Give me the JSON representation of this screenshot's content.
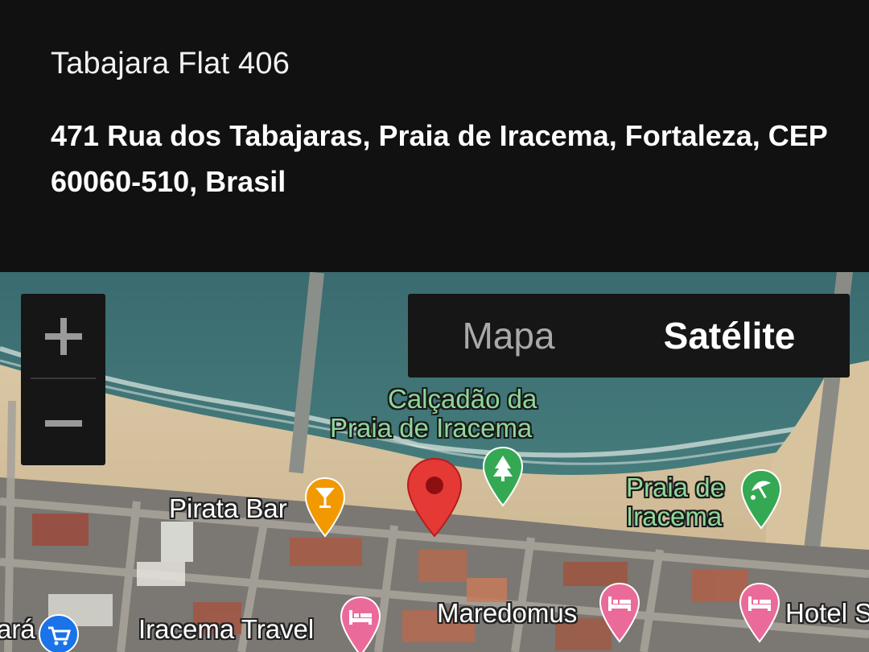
{
  "place": {
    "name": "Tabajara Flat 406",
    "address": "471 Rua dos Tabajaras, Praia de Iracema, Fortaleza, CEP 60060-510, Brasil"
  },
  "map": {
    "view_mode": "satellite",
    "zoom_controls": {
      "zoom_in_icon": "plus-icon",
      "zoom_out_icon": "minus-icon"
    },
    "map_type": {
      "map_label": "Mapa",
      "satellite_label": "Satélite",
      "selected": "Satélite"
    },
    "labels": {
      "calcadao_line1": "Calçadão da",
      "calcadao_line2": "Praia de Iracema",
      "pirata_bar": "Pirata Bar",
      "praia_line1": "Praia de",
      "praia_line2": "Iracema",
      "maredomus": "Maredomus",
      "iracema_travel": "Iracema Travel",
      "hotel_partial": "Hotel S",
      "left_partial": "ará"
    },
    "colors": {
      "marker_red": "#e53935",
      "park_green": "#34a853",
      "bar_orange": "#f29900",
      "hotel_pink": "#ea6b9a",
      "shop_blue": "#1a73e8"
    }
  }
}
